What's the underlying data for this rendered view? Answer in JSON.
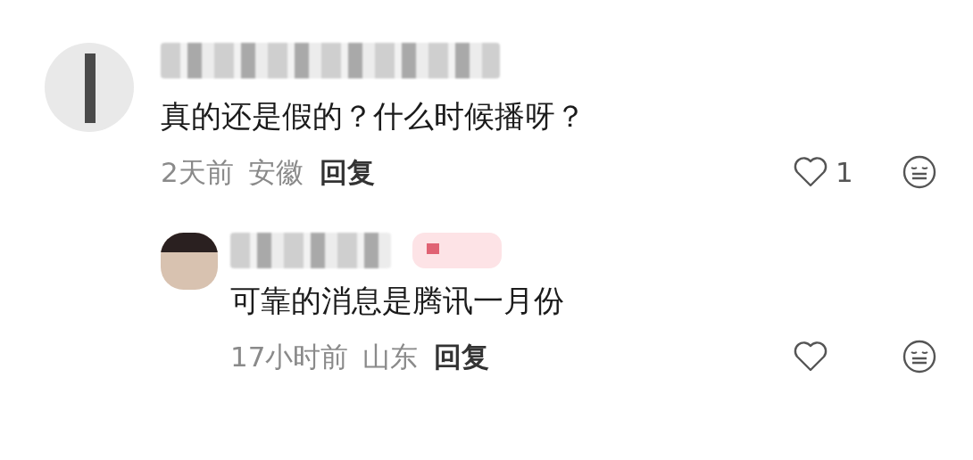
{
  "comments": [
    {
      "text": "真的还是假的？什么时候播呀？",
      "time": "2天前",
      "location": "安徽",
      "reply_label": "回复",
      "likes": "1",
      "badge": false,
      "replies": [
        {
          "text": "可靠的消息是腾讯一月份",
          "time": "17小时前",
          "location": "山东",
          "reply_label": "回复",
          "badge": true
        }
      ]
    }
  ]
}
